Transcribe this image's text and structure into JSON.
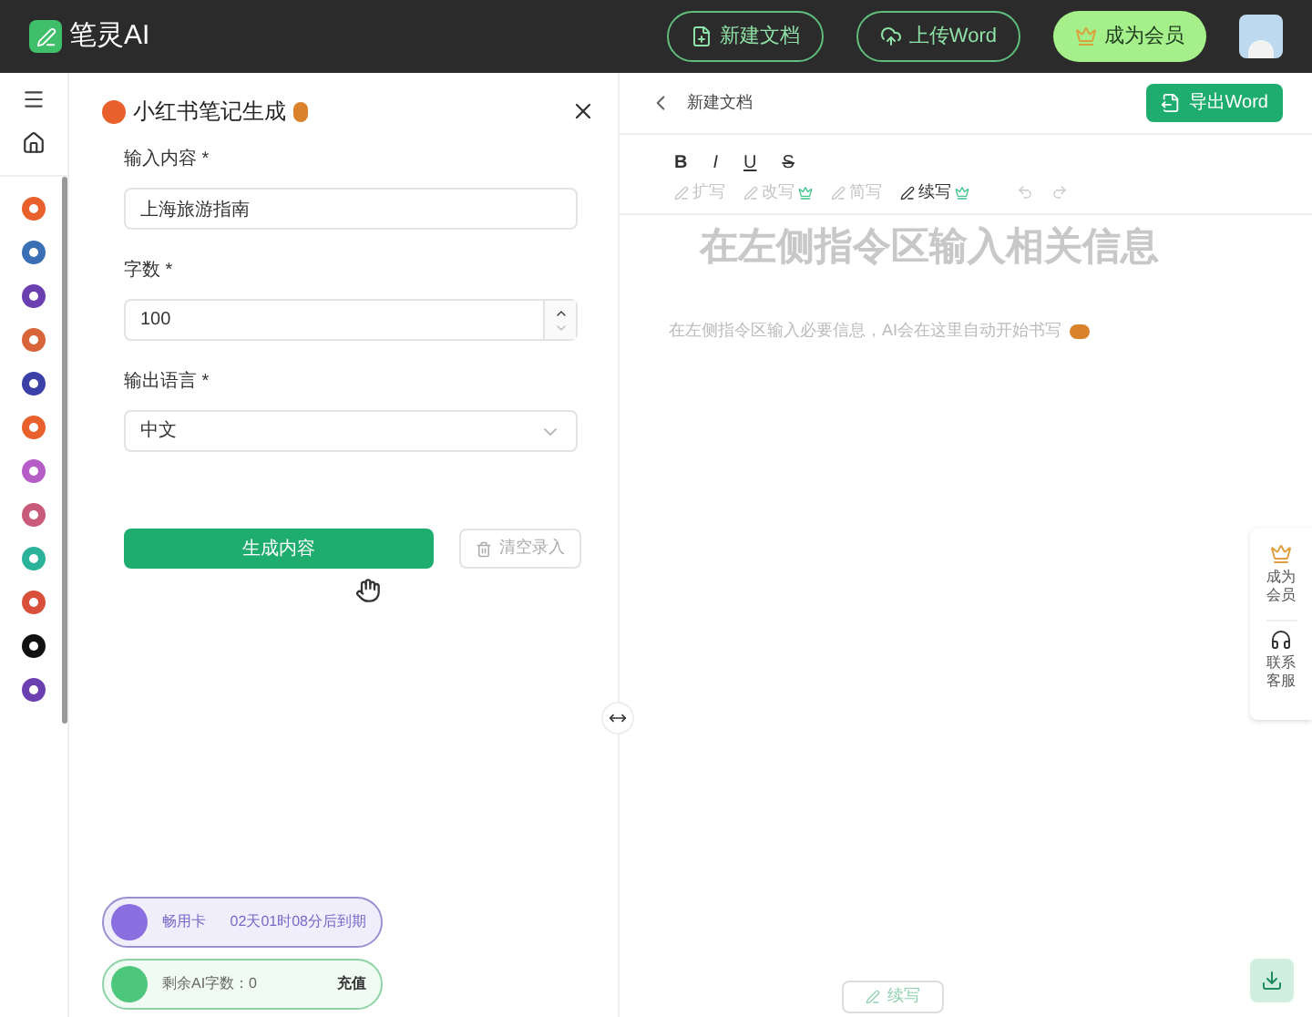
{
  "header": {
    "logo": "笔灵AI",
    "buttons": [
      {
        "kind": "new",
        "label": "新建文档"
      },
      {
        "kind": "upload",
        "label": "上传Word"
      },
      {
        "kind": "vip",
        "label": "成为会员"
      }
    ]
  },
  "rail": {
    "items": [
      {
        "color": "#e8602c"
      },
      {
        "color": "#3b6fb5"
      },
      {
        "color": "#6b3fb0"
      },
      {
        "color": "#d8643a"
      },
      {
        "color": "#3b3fa8"
      },
      {
        "color": "#e8602c"
      },
      {
        "color": "#b65cc7"
      },
      {
        "color": "#c95a7a"
      },
      {
        "color": "#2bb39a"
      },
      {
        "color": "#d9503a"
      },
      {
        "color": "#111111"
      },
      {
        "color": "#6b3fb0"
      }
    ]
  },
  "panel": {
    "title": "小红书笔记生成",
    "fields": [
      {
        "kind": "text",
        "label": "输入内容 *",
        "value": "上海旅游指南"
      },
      {
        "kind": "number",
        "label": "字数 *",
        "value": "100"
      },
      {
        "kind": "select",
        "label": "输出语言 *",
        "value": "中文"
      }
    ],
    "generate": "生成内容",
    "clear": "清空录入",
    "cards": [
      {
        "kind": "card",
        "label": "畅用卡",
        "info": "02天01时08分后到期"
      },
      {
        "kind": "words",
        "label": "剩余AI字数：0",
        "info": "充值"
      }
    ]
  },
  "editor": {
    "doc_title": "新建文档",
    "export": "导出Word",
    "format": [
      "B",
      "I",
      "U",
      "S"
    ],
    "tools": [
      {
        "label": "扩写",
        "disabled": true,
        "premium": false
      },
      {
        "label": "改写",
        "disabled": true,
        "premium": true
      },
      {
        "label": "简写",
        "disabled": true,
        "premium": false
      },
      {
        "label": "续写",
        "disabled": false,
        "premium": true
      }
    ],
    "heading": "在左侧指令区输入相关信息",
    "hint": "在左侧指令区输入必要信息，AI会在这里自动开始书写",
    "continue": "续写"
  },
  "float": [
    {
      "kind": "vip",
      "label": "成为会员"
    },
    {
      "kind": "service",
      "label": "联系客服"
    }
  ]
}
